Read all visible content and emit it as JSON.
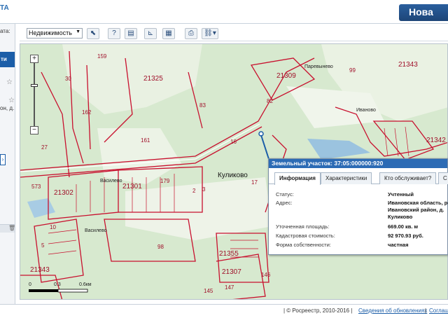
{
  "header": {
    "logo_text": "ТА",
    "new_button": "Нова"
  },
  "left_panel": {
    "date_text": "ата:",
    "search_btn": "ти",
    "addr_text": "он, д."
  },
  "toolbar": {
    "layer_select": "Недвижимость",
    "buttons": [
      "pointer-icon",
      "identify-icon",
      "book-icon",
      "measure-icon",
      "print-icon",
      "link-icon"
    ]
  },
  "map": {
    "labels": [
      {
        "text": "21325"
      },
      {
        "text": "21309"
      },
      {
        "text": "21343"
      },
      {
        "text": "21342"
      },
      {
        "text": "21302"
      },
      {
        "text": "21301"
      },
      {
        "text": "21343"
      },
      {
        "text": "21355"
      },
      {
        "text": "21307"
      },
      {
        "text": "Куликово"
      },
      {
        "text": "Василево"
      },
      {
        "text": "Василево"
      },
      {
        "text": "Паревынево"
      },
      {
        "text": "Иваново"
      },
      {
        "text": "159"
      },
      {
        "text": "30"
      },
      {
        "text": "162"
      },
      {
        "text": "161"
      },
      {
        "text": "27"
      },
      {
        "text": "99"
      },
      {
        "text": "82"
      },
      {
        "text": "98"
      },
      {
        "text": "147"
      },
      {
        "text": "146"
      },
      {
        "text": "145"
      },
      {
        "text": "83"
      },
      {
        "text": "573"
      },
      {
        "text": "179"
      },
      {
        "text": "5"
      },
      {
        "text": "10"
      },
      {
        "text": "3"
      },
      {
        "text": "2"
      },
      {
        "text": "16"
      },
      {
        "text": "17"
      }
    ],
    "scale": {
      "zero": "0",
      "mid": "0.3",
      "end": "0.6км"
    }
  },
  "popup": {
    "title": "Земельный участок: 37:05:000000:920",
    "tabs": [
      "Информация",
      "Характеристики",
      "Кто обслуживает?",
      "С"
    ],
    "rows": [
      {
        "label": "Статус:",
        "value": "Учтенный"
      },
      {
        "label": "Адрес:",
        "value": "Ивановская область, р-н"
      },
      {
        "label": "",
        "value": "Ивановский район, д."
      },
      {
        "label": "",
        "value": "Куликово"
      },
      {
        "label": "Уточненная площадь:",
        "value": "669.00 кв. м"
      },
      {
        "label": "Кадастровая стоимость:",
        "value": "92 970.93 руб."
      },
      {
        "label": "Форма собственности:",
        "value": "частная"
      }
    ]
  },
  "footer": {
    "copyright": "| © Росреестр, 2010-2016 |",
    "updates_link": "Сведения об обновлениях",
    "sep": "|",
    "agreement_link": "Соглаш"
  }
}
